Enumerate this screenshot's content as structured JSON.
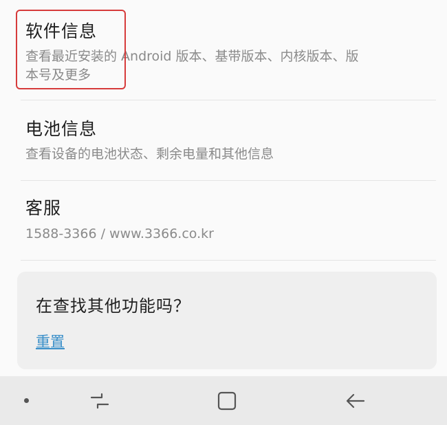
{
  "settings": {
    "items": [
      {
        "title": "软件信息",
        "description_line1": "查看最近安装的 Android 版本、基带版本、内核版本、版",
        "description_line2": "本号及更多"
      },
      {
        "title": "电池信息",
        "description_line1": "查看设备的电池状态、剩余电量和其他信息"
      },
      {
        "title": "客服",
        "description_line1": "1588-3366 / www.3366.co.kr"
      }
    ]
  },
  "suggestion_card": {
    "title": "在查找其他功能吗？",
    "link_label": "重置"
  },
  "navbar": {
    "buttons": [
      "dot-icon",
      "recent-apps-icon",
      "home-icon",
      "back-icon"
    ]
  },
  "colors": {
    "highlight": "#d63a3a",
    "link": "#3a8fc9",
    "background": "#fafafa",
    "navbar": "#eaeaea"
  }
}
